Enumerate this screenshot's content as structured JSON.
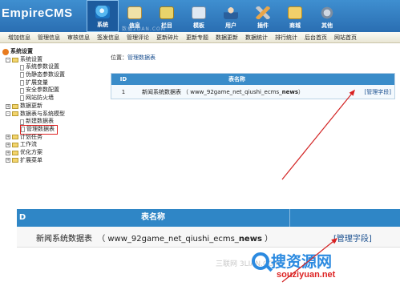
{
  "header": {
    "logo_text": "EmpireCMS",
    "nav": [
      {
        "label": "系统",
        "icon": "system-globe-icon",
        "active": true
      },
      {
        "label": "信息",
        "icon": "info-notepad-icon",
        "active": false
      },
      {
        "label": "栏目",
        "icon": "column-folder-icon",
        "active": false
      },
      {
        "label": "模板",
        "icon": "template-window-icon",
        "active": false
      },
      {
        "label": "用户",
        "icon": "user-person-icon",
        "active": false
      },
      {
        "label": "插件",
        "icon": "plugin-tools-icon",
        "active": false
      },
      {
        "label": "商城",
        "icon": "shop-cart-icon",
        "active": false
      },
      {
        "label": "其他",
        "icon": "other-gear-icon",
        "active": false
      }
    ],
    "watermark": "数据2DAN.COM"
  },
  "submenu": [
    "增加信息",
    "管理信息",
    "审核信息",
    "签发信息",
    "管理评论",
    "更新碎片",
    "更新专题",
    "数据更新",
    "数据统计",
    "排行统计",
    "后台首页",
    "网站首页"
  ],
  "tree": {
    "root": "系统设置",
    "nodes": [
      {
        "label": "系统设置",
        "level": 1,
        "type": "folder",
        "toggle": "-"
      },
      {
        "label": "系统参数设置",
        "level": 2,
        "type": "doc"
      },
      {
        "label": "伪静态参数设置",
        "level": 2,
        "type": "doc"
      },
      {
        "label": "扩展变量",
        "level": 2,
        "type": "doc"
      },
      {
        "label": "安全参数配置",
        "level": 2,
        "type": "doc"
      },
      {
        "label": "网站防火墙",
        "level": 2,
        "type": "doc"
      },
      {
        "label": "数据更新",
        "level": 1,
        "type": "folder",
        "toggle": "+"
      },
      {
        "label": "数据表与系统模型",
        "level": 1,
        "type": "folder",
        "toggle": "-"
      },
      {
        "label": "新建数据表",
        "level": 2,
        "type": "doc"
      },
      {
        "label": "管理数据表",
        "level": 2,
        "type": "doc",
        "highlight": true
      },
      {
        "label": "计划任务",
        "level": 1,
        "type": "folder",
        "toggle": "+"
      },
      {
        "label": "工作流",
        "level": 1,
        "type": "folder",
        "toggle": "+"
      },
      {
        "label": "优化方案",
        "level": 1,
        "type": "folder",
        "toggle": "+"
      },
      {
        "label": "扩展菜单",
        "level": 1,
        "type": "folder",
        "toggle": "+"
      }
    ]
  },
  "main": {
    "location_label": "位置：",
    "location_link": "管理数据表",
    "table": {
      "col_id": "ID",
      "col_name": "表名称",
      "rows": [
        {
          "id": "1",
          "name": "新闻系统数据表",
          "table_prefix": "（ www_92game_net_qiushi_ecms_",
          "table_suffix": "news",
          "table_close": " ）",
          "action": "[管理字段]"
        }
      ]
    }
  },
  "zoom": {
    "col_id": "D",
    "col_name": "表名称",
    "row": {
      "name": "新闻系统数据表",
      "table_prefix": "（ www_92game_net_qiushi_ecms_",
      "table_suffix": "news",
      "table_close": " ）",
      "action": "[管理字段]"
    }
  },
  "overlay": {
    "watermark_left": "三联网 3LIAN.COM",
    "watermark_logo": "搜资源网",
    "watermark_url": "souziyuan.net",
    "arrow_color": "#d22222"
  }
}
